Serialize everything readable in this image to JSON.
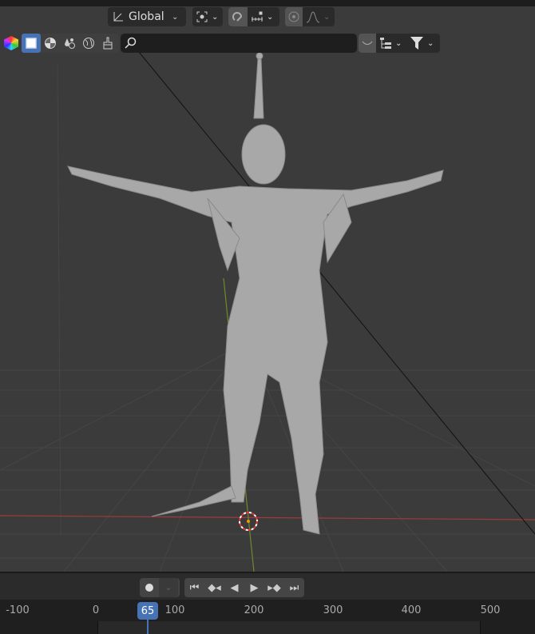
{
  "header": {
    "transform_orientation": "Global",
    "search": {
      "value": "",
      "placeholder": ""
    }
  },
  "icons": [
    "transform-orientation-icon",
    "pivot-icon",
    "snap-icon",
    "snap-increment-icon",
    "proportional-edit-icon",
    "falloff-icon",
    "color-wheel-icon",
    "restrict-select-icon",
    "render-icon",
    "material-icon",
    "world-icon",
    "brush-icon",
    "search-icon",
    "hide-icon",
    "hierarchy-icon",
    "filter-icon"
  ],
  "timeline": {
    "current_frame": "65",
    "ruler_ticks": [
      "-100",
      "0",
      "100",
      "200",
      "300",
      "400",
      "500"
    ],
    "playback": [
      "jump-start",
      "prev-keyframe",
      "play-reverse",
      "play",
      "next-keyframe",
      "jump-end"
    ]
  },
  "colors": {
    "accent": "#4772b3",
    "x_axis": "#b5393c",
    "y_axis": "#7a9a2c",
    "viewport_bg": "#3b3b3b"
  }
}
